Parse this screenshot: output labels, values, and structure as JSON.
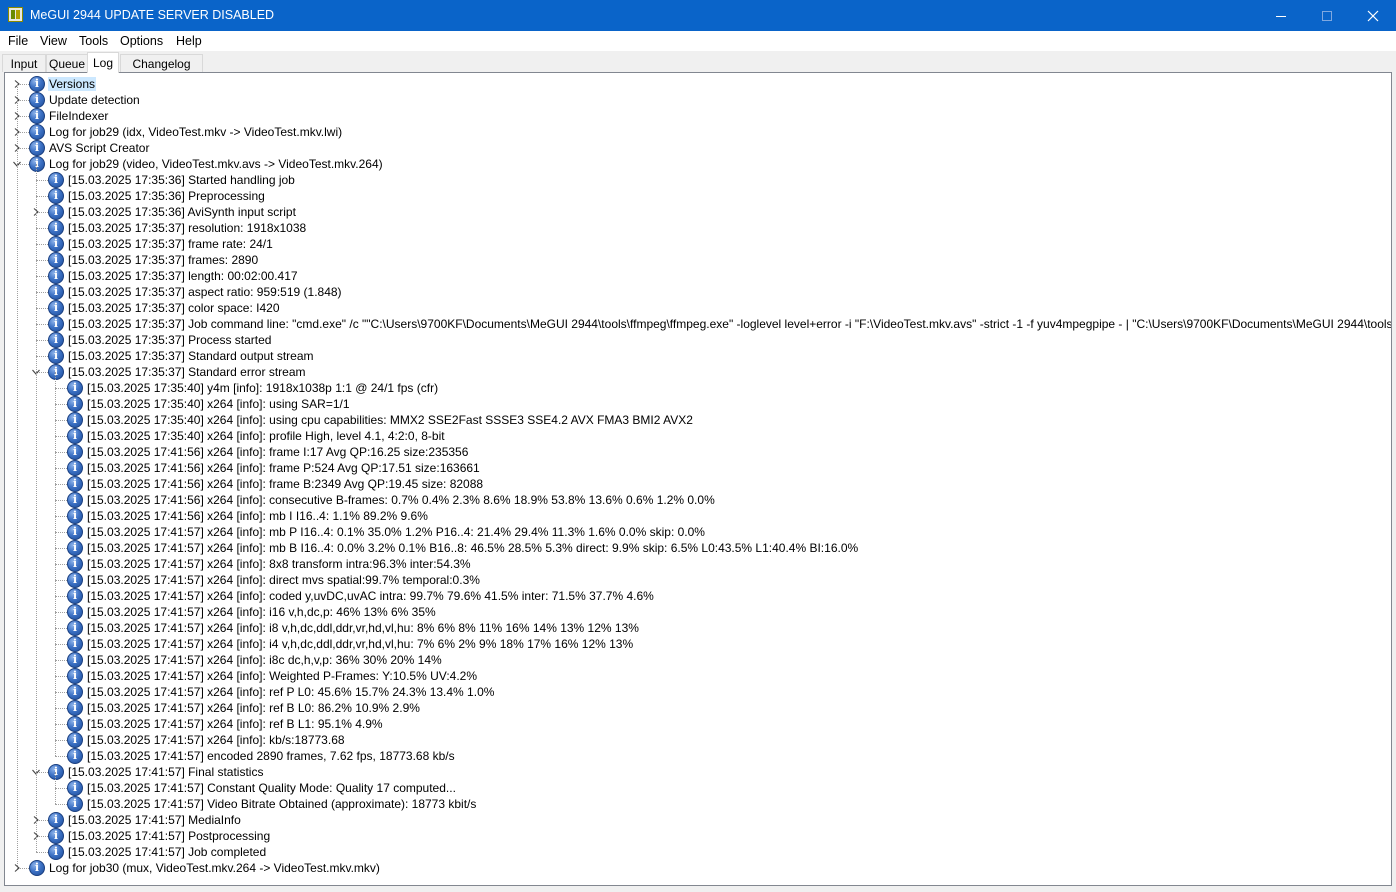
{
  "window": {
    "title": "MeGUI 2944 UPDATE SERVER DISABLED",
    "title_bar_color": "#0a64c9"
  },
  "menu": [
    "File",
    "View",
    "Tools",
    "Options",
    "Help"
  ],
  "tabs": [
    {
      "label": "Input",
      "active": false
    },
    {
      "label": "Queue",
      "active": false
    },
    {
      "label": "Log",
      "active": true
    },
    {
      "label": "Changelog",
      "active": false
    }
  ],
  "log_tree": [
    {
      "level": 0,
      "expander": "collapsed",
      "label": "Versions",
      "selected": true
    },
    {
      "level": 0,
      "expander": "collapsed",
      "label": "Update detection"
    },
    {
      "level": 0,
      "expander": "collapsed",
      "label": "FileIndexer"
    },
    {
      "level": 0,
      "expander": "collapsed",
      "label": "Log for job29 (idx, VideoTest.mkv -> VideoTest.mkv.lwi)"
    },
    {
      "level": 0,
      "expander": "collapsed",
      "label": "AVS Script Creator"
    },
    {
      "level": 0,
      "expander": "expanded",
      "label": "Log for job29 (video, VideoTest.mkv.avs -> VideoTest.mkv.264)"
    },
    {
      "level": 1,
      "expander": "none",
      "label": "[15.03.2025 17:35:36] Started handling job"
    },
    {
      "level": 1,
      "expander": "none",
      "label": "[15.03.2025 17:35:36] Preprocessing"
    },
    {
      "level": 1,
      "expander": "collapsed",
      "label": "[15.03.2025 17:35:36] AviSynth input script"
    },
    {
      "level": 1,
      "expander": "none",
      "label": "[15.03.2025 17:35:37] resolution: 1918x1038"
    },
    {
      "level": 1,
      "expander": "none",
      "label": "[15.03.2025 17:35:37] frame rate: 24/1"
    },
    {
      "level": 1,
      "expander": "none",
      "label": "[15.03.2025 17:35:37] frames: 2890"
    },
    {
      "level": 1,
      "expander": "none",
      "label": "[15.03.2025 17:35:37] length: 00:02:00.417"
    },
    {
      "level": 1,
      "expander": "none",
      "label": "[15.03.2025 17:35:37] aspect ratio: 959:519 (1.848)"
    },
    {
      "level": 1,
      "expander": "none",
      "label": "[15.03.2025 17:35:37] color space: I420"
    },
    {
      "level": 1,
      "expander": "none",
      "label": "[15.03.2025 17:35:37] Job command line: \"cmd.exe\" /c \"\"C:\\Users\\9700KF\\Documents\\MeGUI 2944\\tools\\ffmpeg\\ffmpeg.exe\" -loglevel level+error -i \"F:\\VideoTest.mkv.avs\" -strict -1 -f yuv4mpegpipe - | \"C:\\Users\\9700KF\\Documents\\MeGUI 2944\\tools\\x264\\x264.exe\" --le"
    },
    {
      "level": 1,
      "expander": "none",
      "label": "[15.03.2025 17:35:37] Process started"
    },
    {
      "level": 1,
      "expander": "none",
      "label": "[15.03.2025 17:35:37] Standard output stream"
    },
    {
      "level": 1,
      "expander": "expanded",
      "label": "[15.03.2025 17:35:37] Standard error stream"
    },
    {
      "level": 2,
      "expander": "none",
      "label": "[15.03.2025 17:35:40] y4m [info]: 1918x1038p 1:1 @ 24/1 fps (cfr)"
    },
    {
      "level": 2,
      "expander": "none",
      "label": "[15.03.2025 17:35:40] x264 [info]: using SAR=1/1"
    },
    {
      "level": 2,
      "expander": "none",
      "label": "[15.03.2025 17:35:40] x264 [info]: using cpu capabilities: MMX2 SSE2Fast SSSE3 SSE4.2 AVX FMA3 BMI2 AVX2"
    },
    {
      "level": 2,
      "expander": "none",
      "label": "[15.03.2025 17:35:40] x264 [info]: profile High, level 4.1, 4:2:0, 8-bit"
    },
    {
      "level": 2,
      "expander": "none",
      "label": "[15.03.2025 17:41:56] x264 [info]: frame I:17    Avg QP:16.25  size:235356"
    },
    {
      "level": 2,
      "expander": "none",
      "label": "[15.03.2025 17:41:56] x264 [info]: frame P:524   Avg QP:17.51  size:163661"
    },
    {
      "level": 2,
      "expander": "none",
      "label": "[15.03.2025 17:41:56] x264 [info]: frame B:2349  Avg QP:19.45  size: 82088"
    },
    {
      "level": 2,
      "expander": "none",
      "label": "[15.03.2025 17:41:56] x264 [info]: consecutive B-frames:  0.7%  0.4%  2.3%  8.6% 18.9% 53.8% 13.6%  0.6%  1.2%  0.0%"
    },
    {
      "level": 2,
      "expander": "none",
      "label": "[15.03.2025 17:41:56] x264 [info]: mb I  I16..4:  1.1% 89.2%  9.6%"
    },
    {
      "level": 2,
      "expander": "none",
      "label": "[15.03.2025 17:41:57] x264 [info]: mb P  I16..4:  0.1% 35.0%  1.2%  P16..4: 21.4% 29.4% 11.3%  1.6%  0.0%    skip: 0.0%"
    },
    {
      "level": 2,
      "expander": "none",
      "label": "[15.03.2025 17:41:57] x264 [info]: mb B  I16..4:  0.0%  3.2%  0.1%  B16..8: 46.5% 28.5%  5.3%  direct: 9.9%  skip: 6.5%  L0:43.5% L1:40.4% BI:16.0%"
    },
    {
      "level": 2,
      "expander": "none",
      "label": "[15.03.2025 17:41:57] x264 [info]: 8x8 transform intra:96.3% inter:54.3%"
    },
    {
      "level": 2,
      "expander": "none",
      "label": "[15.03.2025 17:41:57] x264 [info]: direct mvs  spatial:99.7% temporal:0.3%"
    },
    {
      "level": 2,
      "expander": "none",
      "label": "[15.03.2025 17:41:57] x264 [info]: coded y,uvDC,uvAC intra: 99.7% 79.6% 41.5% inter: 71.5% 37.7% 4.6%"
    },
    {
      "level": 2,
      "expander": "none",
      "label": "[15.03.2025 17:41:57] x264 [info]: i16 v,h,dc,p: 46% 13%  6% 35%"
    },
    {
      "level": 2,
      "expander": "none",
      "label": "[15.03.2025 17:41:57] x264 [info]: i8 v,h,dc,ddl,ddr,vr,hd,vl,hu:  8%  6%  8% 11% 16% 14% 13% 12% 13%"
    },
    {
      "level": 2,
      "expander": "none",
      "label": "[15.03.2025 17:41:57] x264 [info]: i4 v,h,dc,ddl,ddr,vr,hd,vl,hu:  7%  6%  2%  9% 18% 17% 16% 12% 13%"
    },
    {
      "level": 2,
      "expander": "none",
      "label": "[15.03.2025 17:41:57] x264 [info]: i8c dc,h,v,p: 36% 30% 20% 14%"
    },
    {
      "level": 2,
      "expander": "none",
      "label": "[15.03.2025 17:41:57] x264 [info]: Weighted P-Frames: Y:10.5% UV:4.2%"
    },
    {
      "level": 2,
      "expander": "none",
      "label": "[15.03.2025 17:41:57] x264 [info]: ref P L0: 45.6% 15.7% 24.3% 13.4%  1.0%"
    },
    {
      "level": 2,
      "expander": "none",
      "label": "[15.03.2025 17:41:57] x264 [info]: ref B L0: 86.2% 10.9%  2.9%"
    },
    {
      "level": 2,
      "expander": "none",
      "label": "[15.03.2025 17:41:57] x264 [info]: ref B L1: 95.1%  4.9%"
    },
    {
      "level": 2,
      "expander": "none",
      "label": "[15.03.2025 17:41:57] x264 [info]: kb/s:18773.68"
    },
    {
      "level": 2,
      "expander": "none",
      "label": "[15.03.2025 17:41:57] encoded 2890 frames, 7.62 fps, 18773.68 kb/s"
    },
    {
      "level": 1,
      "expander": "expanded",
      "label": "[15.03.2025 17:41:57] Final statistics"
    },
    {
      "level": 2,
      "expander": "none",
      "label": "[15.03.2025 17:41:57] Constant Quality Mode: Quality 17 computed..."
    },
    {
      "level": 2,
      "expander": "none",
      "label": "[15.03.2025 17:41:57] Video Bitrate Obtained (approximate): 18773 kbit/s"
    },
    {
      "level": 1,
      "expander": "collapsed",
      "label": "[15.03.2025 17:41:57] MediaInfo"
    },
    {
      "level": 1,
      "expander": "collapsed",
      "label": "[15.03.2025 17:41:57] Postprocessing"
    },
    {
      "level": 1,
      "expander": "none",
      "label": "[15.03.2025 17:41:57] Job completed"
    },
    {
      "level": 0,
      "expander": "collapsed",
      "label": "Log for job30 (mux, VideoTest.mkv.264 -> VideoTest.mkv.mkv)"
    }
  ]
}
